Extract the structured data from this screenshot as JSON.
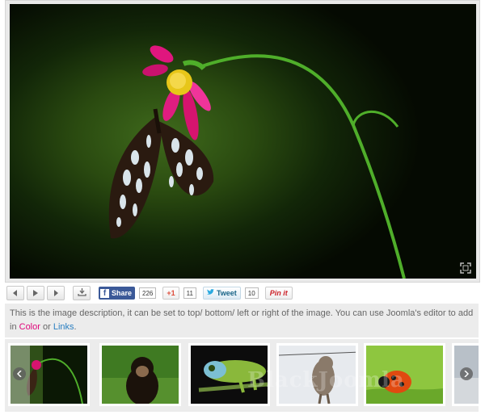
{
  "toolbar": {
    "facebook_label": "Share",
    "facebook_count": "226",
    "gplus_label": "+1",
    "gplus_count": "11",
    "tweet_label": "Tweet",
    "tweet_count": "10",
    "pinit_label": "Pin it"
  },
  "description": {
    "text_before": "This is the image description, it can be set to top/ bottom/ left or right of the image. You can use Joomla's editor to add in ",
    "link_color": "Color",
    "text_middle": " or ",
    "link_links": "Links",
    "text_after": "."
  },
  "thumbnails": [
    {
      "subject": "butterfly on flower"
    },
    {
      "subject": "chimpanzee"
    },
    {
      "subject": "chameleon"
    },
    {
      "subject": "lynx in snow"
    },
    {
      "subject": "ladybug"
    },
    {
      "subject": "partial"
    }
  ],
  "watermark": "BlackJoomla",
  "colors": {
    "link_color": "#e0067a",
    "link_links": "#2a7fc1",
    "facebook": "#3b5998"
  },
  "icons": [
    "prev-icon",
    "play-icon",
    "next-icon",
    "download-icon",
    "fullscreen-icon",
    "thumb-prev-icon",
    "thumb-next-icon"
  ]
}
